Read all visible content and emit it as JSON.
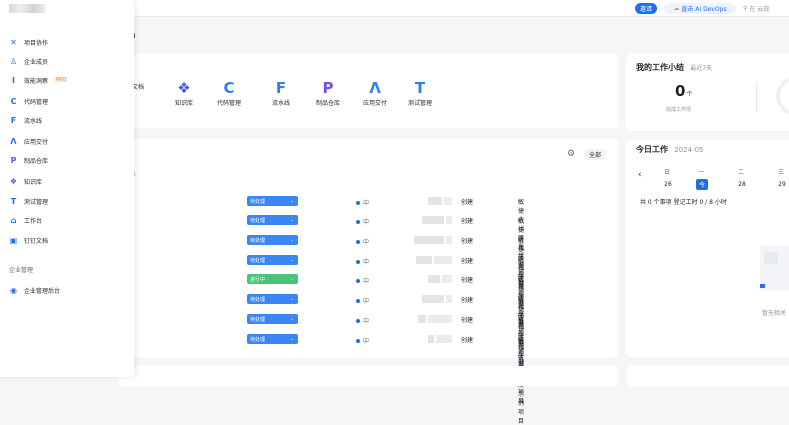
{
  "topbar": {
    "invite_label": "邀请",
    "ai_label": "直击 AI DevOps",
    "search_placeholder": "在 云效"
  },
  "flyout": {
    "items": [
      {
        "icon": "collab-icon",
        "glyph": "✕",
        "color": "#1f6fea",
        "label": "项目协作"
      },
      {
        "icon": "members-icon",
        "glyph": "♙",
        "color": "#1f6fea",
        "label": "企业成员"
      },
      {
        "icon": "insight-icon",
        "glyph": "I",
        "color": "#1f6fea",
        "label": "效能洞察",
        "badge": "PRO"
      },
      {
        "icon": "code-icon",
        "glyph": "C",
        "color": "#1f6fea",
        "label": "代码管理"
      },
      {
        "icon": "pipeline-icon",
        "glyph": "F",
        "color": "#1f6fea",
        "label": "流水线"
      },
      {
        "icon": "delivery-icon",
        "glyph": "Λ",
        "color": "#1f6fea",
        "label": "应用交付"
      },
      {
        "icon": "artifact-icon",
        "glyph": "P",
        "color": "#7a4cf0",
        "label": "制品仓库"
      },
      {
        "icon": "knowledge-icon",
        "glyph": "❖",
        "color": "#3a5be8",
        "label": "知识库"
      },
      {
        "icon": "testing-icon",
        "glyph": "T",
        "color": "#1f6fea",
        "label": "测试管理"
      },
      {
        "icon": "workbench-icon",
        "glyph": "⌂",
        "color": "#1f6fea",
        "label": "工作台"
      },
      {
        "icon": "dingtalk-doc-icon",
        "glyph": "▣",
        "color": "#1f6fea",
        "label": "钉钉文档"
      }
    ],
    "section_label": "企业管理",
    "admin": {
      "icon": "admin-icon",
      "glyph": "◉",
      "color": "#1f6fea",
      "label": "企业管理后台"
    }
  },
  "main": {
    "title_fragment": "n",
    "apps": [
      {
        "icon": "docs-app-icon",
        "glyph": "",
        "label": "文档"
      },
      {
        "icon": "knowledge-app-icon",
        "glyph": "❖",
        "label": "知识库"
      },
      {
        "icon": "code-app-icon",
        "glyph": "C",
        "label": "代码管理"
      },
      {
        "icon": "pipeline-app-icon",
        "glyph": "F",
        "label": "流水线"
      },
      {
        "icon": "artifact-app-icon",
        "glyph": "P",
        "label": "制品仓库"
      },
      {
        "icon": "delivery-app-icon",
        "glyph": "Λ",
        "label": "应用交付"
      },
      {
        "icon": "testing-app-icon",
        "glyph": "T",
        "label": "测试管理"
      }
    ],
    "filter_label": "全部",
    "rows": [
      {
        "status": "待处理",
        "status_color": "#3a86f5",
        "priority": "中",
        "creator_suffix": "创建",
        "project": "敏捷迭代研发示例项目"
      },
      {
        "status": "待处理",
        "status_color": "#3a86f5",
        "priority": "中",
        "creator_suffix": "创建",
        "project": "敏捷迭代研发示例项目"
      },
      {
        "status": "待处理",
        "status_color": "#3a86f5",
        "priority": "中",
        "creator_suffix": "创建",
        "project": "敏捷迭代研发示例项目"
      },
      {
        "status": "待处理",
        "status_color": "#3a86f5",
        "priority": "中",
        "creator_suffix": "创建",
        "project": "敏捷迭代研发示例项目"
      },
      {
        "status": "进行中",
        "status_color": "#4cc27a",
        "priority": "中",
        "creator_suffix": "创建",
        "project": "敏捷迭代研发示例项目"
      },
      {
        "status": "待处理",
        "status_color": "#3a86f5",
        "priority": "中",
        "creator_suffix": "创建",
        "project": "敏捷迭代研发示例项目"
      },
      {
        "status": "待处理",
        "status_color": "#3a86f5",
        "priority": "中",
        "creator_suffix": "创建",
        "project": "敏捷迭代研发示例项目"
      },
      {
        "status": "待处理",
        "status_color": "#3a86f5",
        "priority": "中",
        "creator_suffix": "创建",
        "project": "敏捷迭代研发示例项目"
      }
    ]
  },
  "summary": {
    "title": "我的工作小结",
    "subtitle": "最近7天",
    "count": "0",
    "unit": "个",
    "caption": "完成工作项"
  },
  "today": {
    "title": "今日工作",
    "month": "2024-05",
    "weekdays": [
      "日",
      "一",
      "二",
      "三"
    ],
    "days": [
      "26",
      "今",
      "28",
      "29"
    ],
    "prev_label": "‹",
    "stats": "共 0 个事项  登记工时 0 / 8 小时",
    "empty_text": "暂无相关"
  }
}
